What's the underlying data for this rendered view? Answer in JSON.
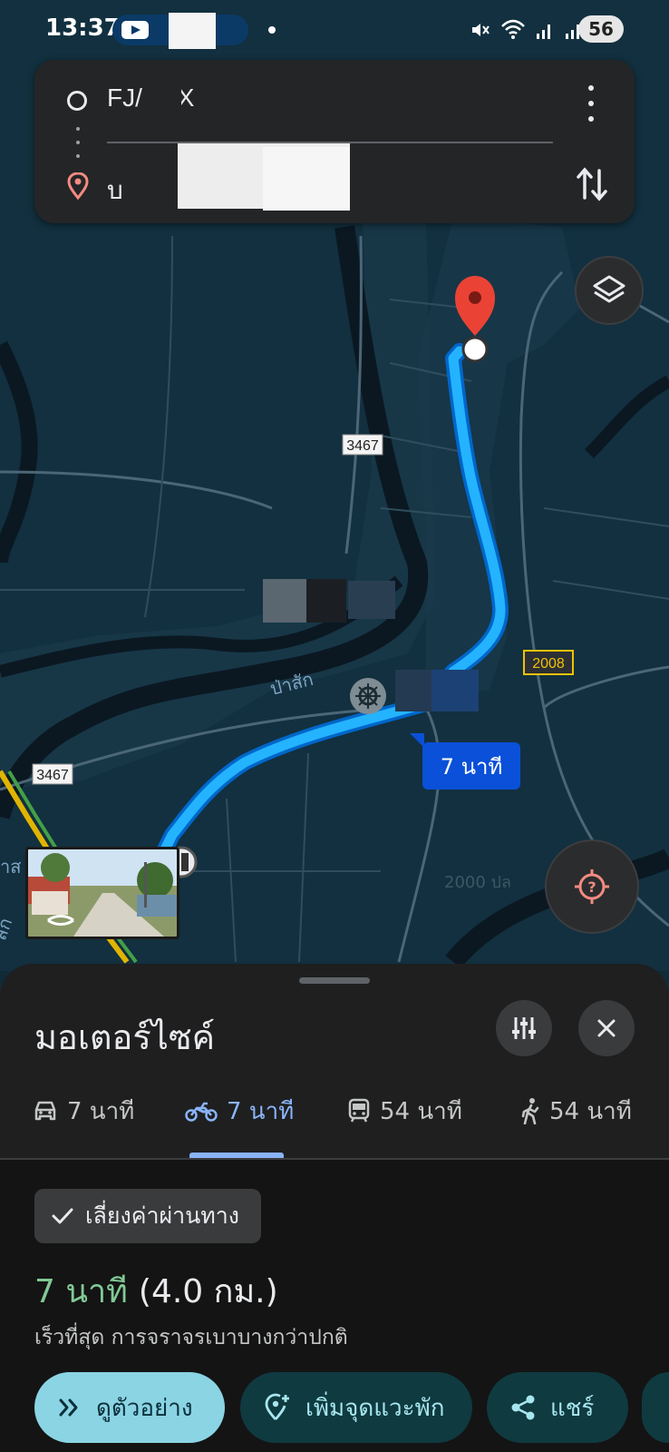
{
  "status_bar": {
    "time": "13:37",
    "battery": "56"
  },
  "route_card": {
    "origin_text": "FJ/   35X",
    "destination_text": "บ"
  },
  "map": {
    "road_labels": [
      "3467",
      "3467",
      "2008",
      "2000 ปล"
    ],
    "place_labels": [
      "ป่าสัก",
      "าส",
      "สก"
    ],
    "route_time_badge": "7 นาที",
    "colors": {
      "background": "#112a38",
      "route": "#24b3ff",
      "badge": "#0a50d8",
      "pin": "#ea4335"
    }
  },
  "sheet": {
    "title": "มอเตอร์ไซค์",
    "tabs": [
      {
        "icon": "car-icon",
        "label": "7 นาที"
      },
      {
        "icon": "motorcycle-icon",
        "label": "7 นาที",
        "active": true
      },
      {
        "icon": "transit-icon",
        "label": "54 นาที"
      },
      {
        "icon": "walk-icon",
        "label": "54 นาที"
      }
    ],
    "chip_label": "เลี่ยงค่าผ่านทาง",
    "route_time": "7 นาที",
    "route_distance": "(4.0 กม.)",
    "route_note": "เร็วที่สุด การจราจรเบาบางกว่าปกติ",
    "buttons": {
      "preview": "ดูตัวอย่าง",
      "add_stop": "เพิ่มจุดแวะพัก",
      "share": "แชร์"
    }
  }
}
